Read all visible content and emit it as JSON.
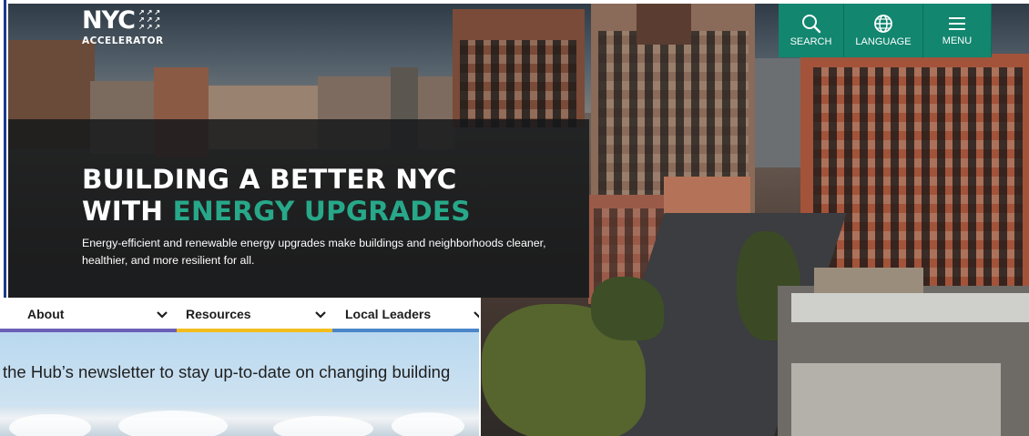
{
  "logo": {
    "wordmark": "NYC",
    "sub": "ACCELERATOR",
    "arrows": [
      "↗↗↗",
      "↗↗↗",
      "↗↗↗"
    ]
  },
  "topnav": [
    {
      "label": "SEARCH",
      "icon": "search-icon"
    },
    {
      "label": "LANGUAGE",
      "icon": "globe-icon"
    },
    {
      "label": "MENU",
      "icon": "hamburger-icon"
    }
  ],
  "hero": {
    "title_line1": "BUILDING A BETTER NYC",
    "title_line2_prefix": "WITH ",
    "title_line2_accent": "ENERGY UPGRADES",
    "description": "Energy-efficient and renewable energy upgrades make buildings and neighborhoods cleaner, healthier, and more resilient for all."
  },
  "tabs": [
    {
      "label": "About",
      "color": "#6a5fb6"
    },
    {
      "label": "Resources",
      "color": "#f2bd1d"
    },
    {
      "label": "Local Leaders",
      "color": "#4a86c8"
    }
  ],
  "newsletter": {
    "text": "the Hub’s newsletter to stay up-to-date on changing building"
  },
  "colors": {
    "nav_green": "#12866f",
    "accent_teal": "#27a889",
    "edge_blue": "#1a3a8c"
  }
}
